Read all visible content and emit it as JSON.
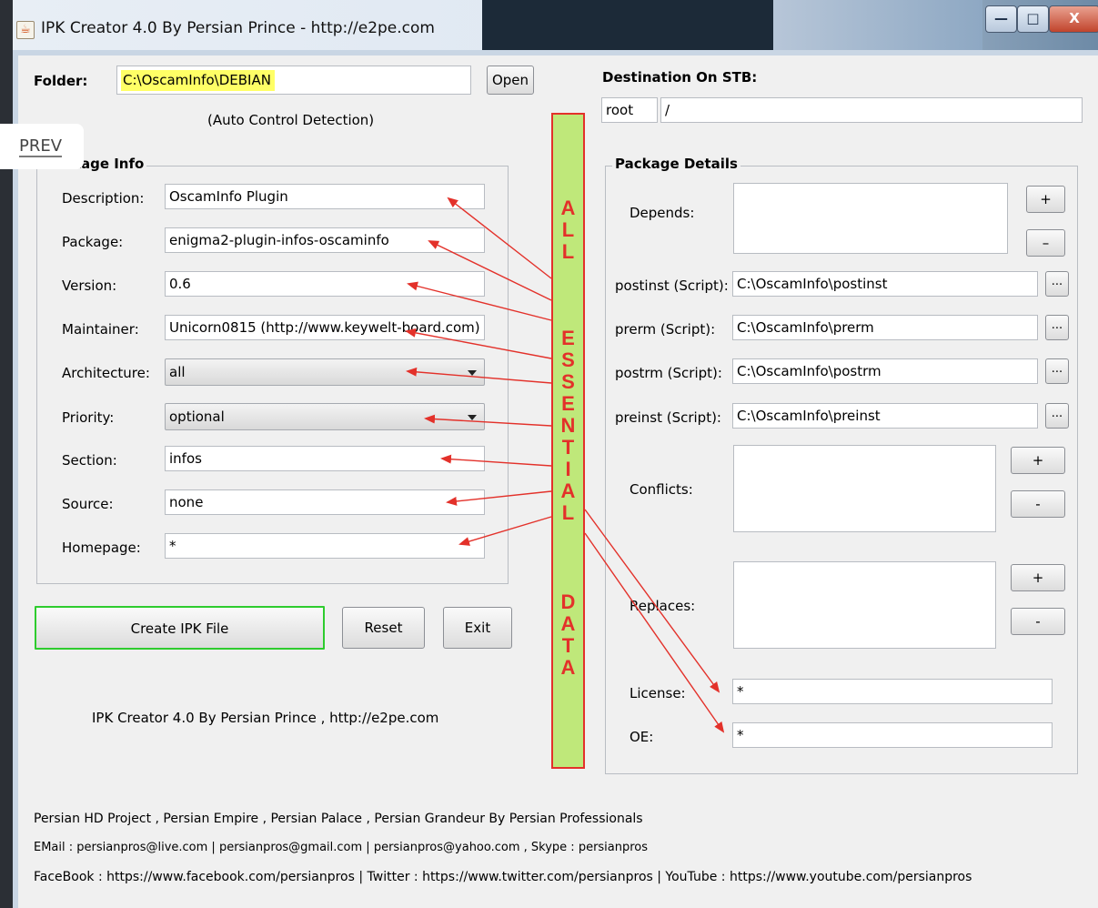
{
  "window": {
    "title": "IPK Creator 4.0 By Persian Prince - http://e2pe.com",
    "app_icon": "java-cup-icon"
  },
  "overlay": {
    "prev_label": "PREV"
  },
  "folder": {
    "label": "Folder:",
    "value": "C:\\OscamInfo\\DEBIAN",
    "open_button": "Open",
    "hint": "(Auto Control Detection)"
  },
  "destination": {
    "label": "Destination On STB:",
    "user": "root",
    "path": "/"
  },
  "package_info": {
    "title": "Package Info",
    "visible_title": "kage Info",
    "fields": [
      {
        "label": "Description:",
        "value": "OscamInfo Plugin"
      },
      {
        "label": "Package:",
        "value": "enigma2-plugin-infos-oscaminfo"
      },
      {
        "label": "Version:",
        "value": "0.6"
      },
      {
        "label": "Maintainer:",
        "value": "Unicorn0815 (http://www.keywelt-board.com)"
      },
      {
        "label": "Architecture:",
        "value": "all"
      },
      {
        "label": "Priority:",
        "value": "optional"
      },
      {
        "label": "Section:",
        "value": "infos"
      },
      {
        "label": "Source:",
        "value": "none"
      },
      {
        "label": "Homepage:",
        "value": "*"
      }
    ]
  },
  "package_details": {
    "title": "Package Details",
    "depends_label": "Depends:",
    "plus": "+",
    "minus": "–",
    "minus_small": "-",
    "browse": "...",
    "scripts": [
      {
        "label": "postinst (Script):",
        "value": "C:\\OscamInfo\\postinst"
      },
      {
        "label": "prerm (Script):",
        "value": "C:\\OscamInfo\\prerm"
      },
      {
        "label": "postrm (Script):",
        "value": "C:\\OscamInfo\\postrm"
      },
      {
        "label": "preinst (Script):",
        "value": "C:\\OscamInfo\\preinst"
      }
    ],
    "conflicts_label": "Conflicts:",
    "replaces_label": "Replaces:",
    "license_label": "License:",
    "license_value": "*",
    "oe_label": "OE:",
    "oe_value": "*"
  },
  "actions": {
    "create": "Create IPK File",
    "reset": "Reset",
    "exit": "Exit"
  },
  "credit": "IPK Creator 4.0 By Persian Prince , http://e2pe.com",
  "annotation": {
    "text_letters": [
      "A",
      "L",
      "L",
      "E",
      "S",
      "S",
      "E",
      "N",
      "T",
      "I",
      "A",
      "L",
      "D",
      "A",
      "T",
      "A"
    ]
  },
  "footer": {
    "line1": "Persian HD Project , Persian Empire , Persian Palace , Persian Grandeur By Persian Professionals",
    "line2": "EMail : persianpros@live.com | persianpros@gmail.com | persianpros@yahoo.com , Skype : persianpros",
    "line3": "FaceBook : https://www.facebook.com/persianpros | Twitter : https://www.twitter.com/persianpros | YouTube : https://www.youtube.com/persianpros"
  },
  "colors": {
    "annotation_red": "#e3312a",
    "banner_green": "#bfe87a",
    "folder_highlight": "#ffff66",
    "create_border": "#2ecc2e"
  }
}
